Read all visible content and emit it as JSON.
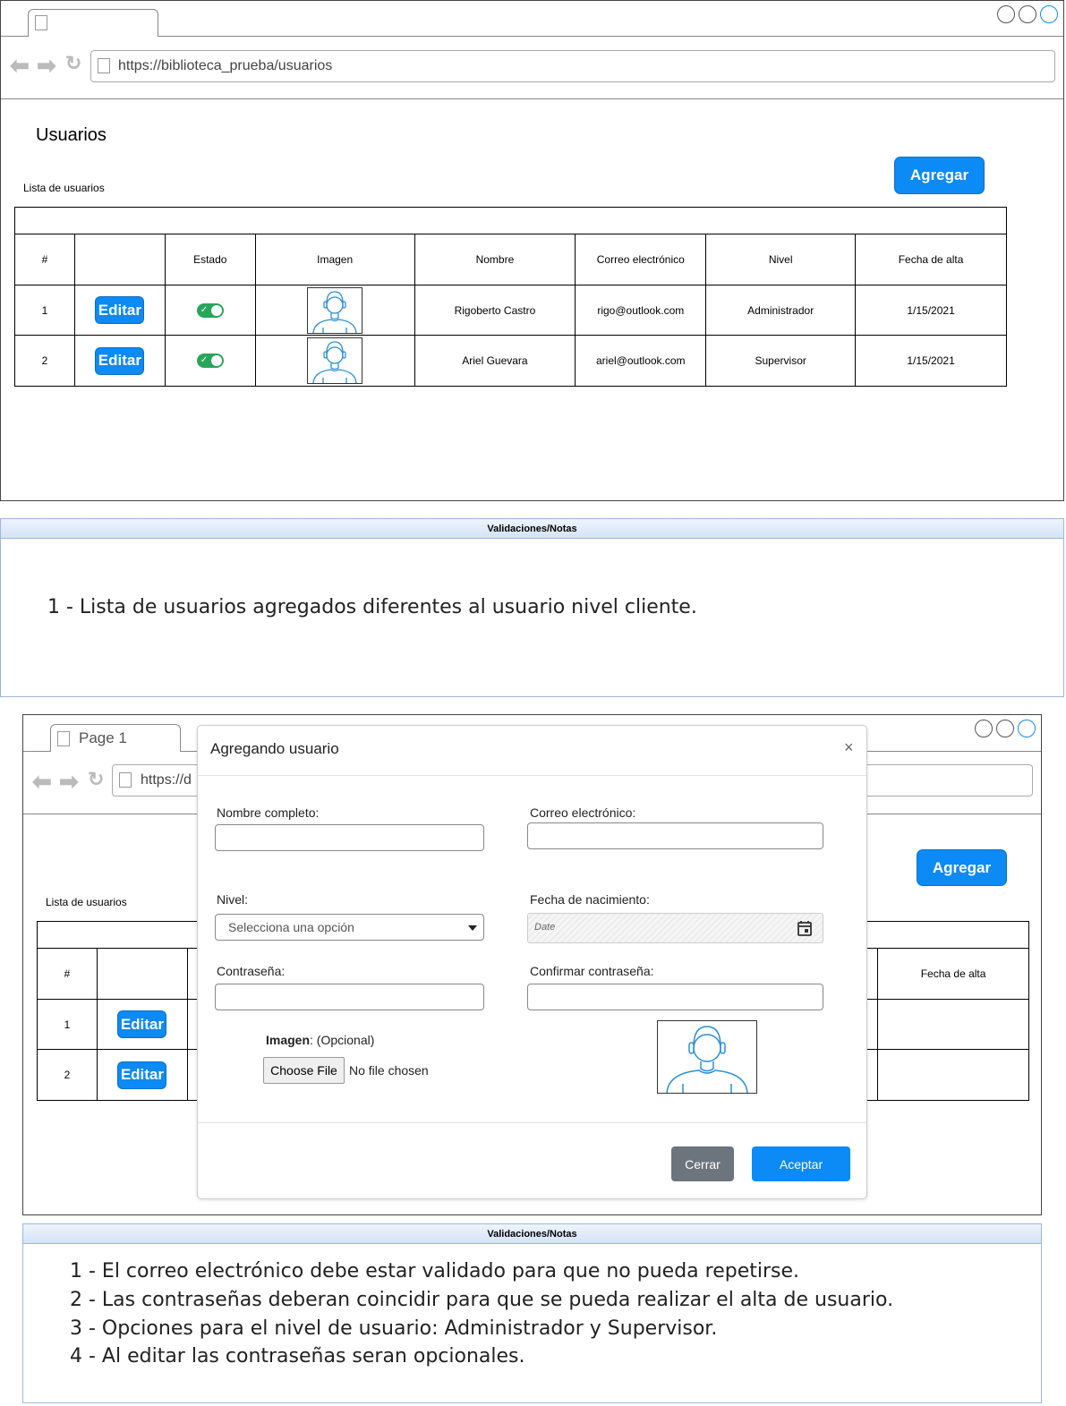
{
  "screen1": {
    "url": "https://biblioteca_prueba/usuarios",
    "page_title": "Usuarios",
    "list_label": "Lista de usuarios",
    "add_button": "Agregar",
    "table": {
      "headers": [
        "#",
        "",
        "Estado",
        "Imagen",
        "Nombre",
        "Correo electrónico",
        "Nivel",
        "Fecha de alta"
      ],
      "rows": [
        {
          "num": "1",
          "edit": "Editar",
          "estado": "on",
          "nombre": "Rigoberto Castro",
          "correo": "rigo@outlook.com",
          "nivel": "Administrador",
          "fecha": "1/15/2021"
        },
        {
          "num": "2",
          "edit": "Editar",
          "estado": "on",
          "nombre": "Ariel Guevara",
          "correo": "ariel@outlook.com",
          "nivel": "Supervisor",
          "fecha": "1/15/2021"
        }
      ]
    }
  },
  "notes1": {
    "title": "Validaciones/Notas",
    "lines": [
      "1 - Lista de usuarios agregados diferentes al usuario nivel cliente."
    ]
  },
  "screen2": {
    "tab_label": "Page 1",
    "url_partial": "https://d",
    "list_label": "Lista de usuarios",
    "add_button": "Agregar",
    "table": {
      "headers": [
        "#",
        "Fecha de alta"
      ],
      "rows": [
        {
          "num": "1",
          "edit": "Editar"
        },
        {
          "num": "2",
          "edit": "Editar"
        }
      ]
    },
    "modal": {
      "title": "Agregando usuario",
      "close_symbol": "×",
      "nombre_label": "Nombre completo:",
      "correo_label": "Correo electrónico:",
      "nivel_label": "Nivel:",
      "nivel_placeholder": "Selecciona una opción",
      "fecha_label": "Fecha de nacimiento:",
      "fecha_placeholder": "Date",
      "pass_label": "Contraseña:",
      "confirm_label": "Confirmar contraseña:",
      "imagen_label": "Imagen",
      "imagen_optional": ": (Opcional)",
      "file_button": "Choose File",
      "file_status": "No file chosen",
      "cerrar": "Cerrar",
      "aceptar": "Aceptar"
    }
  },
  "notes2": {
    "title": "Validaciones/Notas",
    "lines": [
      "1 - El correo electrónico debe estar validado para que no pueda repetirse.",
      "2 - Las contraseñas deberan coincidir para que se pueda realizar el alta de usuario.",
      "3 - Opciones para el nivel de usuario: Administrador y Supervisor.",
      "4 - Al editar las contraseñas seran opcionales."
    ]
  },
  "colors": {
    "accent": "#0c8af5",
    "toggle_on": "#27a65a",
    "notes_border": "#9db7dd",
    "close_button": "#6c757d"
  },
  "icons": [
    "back-arrow-icon",
    "forward-arrow-icon",
    "reload-icon",
    "page-icon",
    "calendar-icon",
    "caret-down-icon",
    "user-avatar-icon"
  ]
}
